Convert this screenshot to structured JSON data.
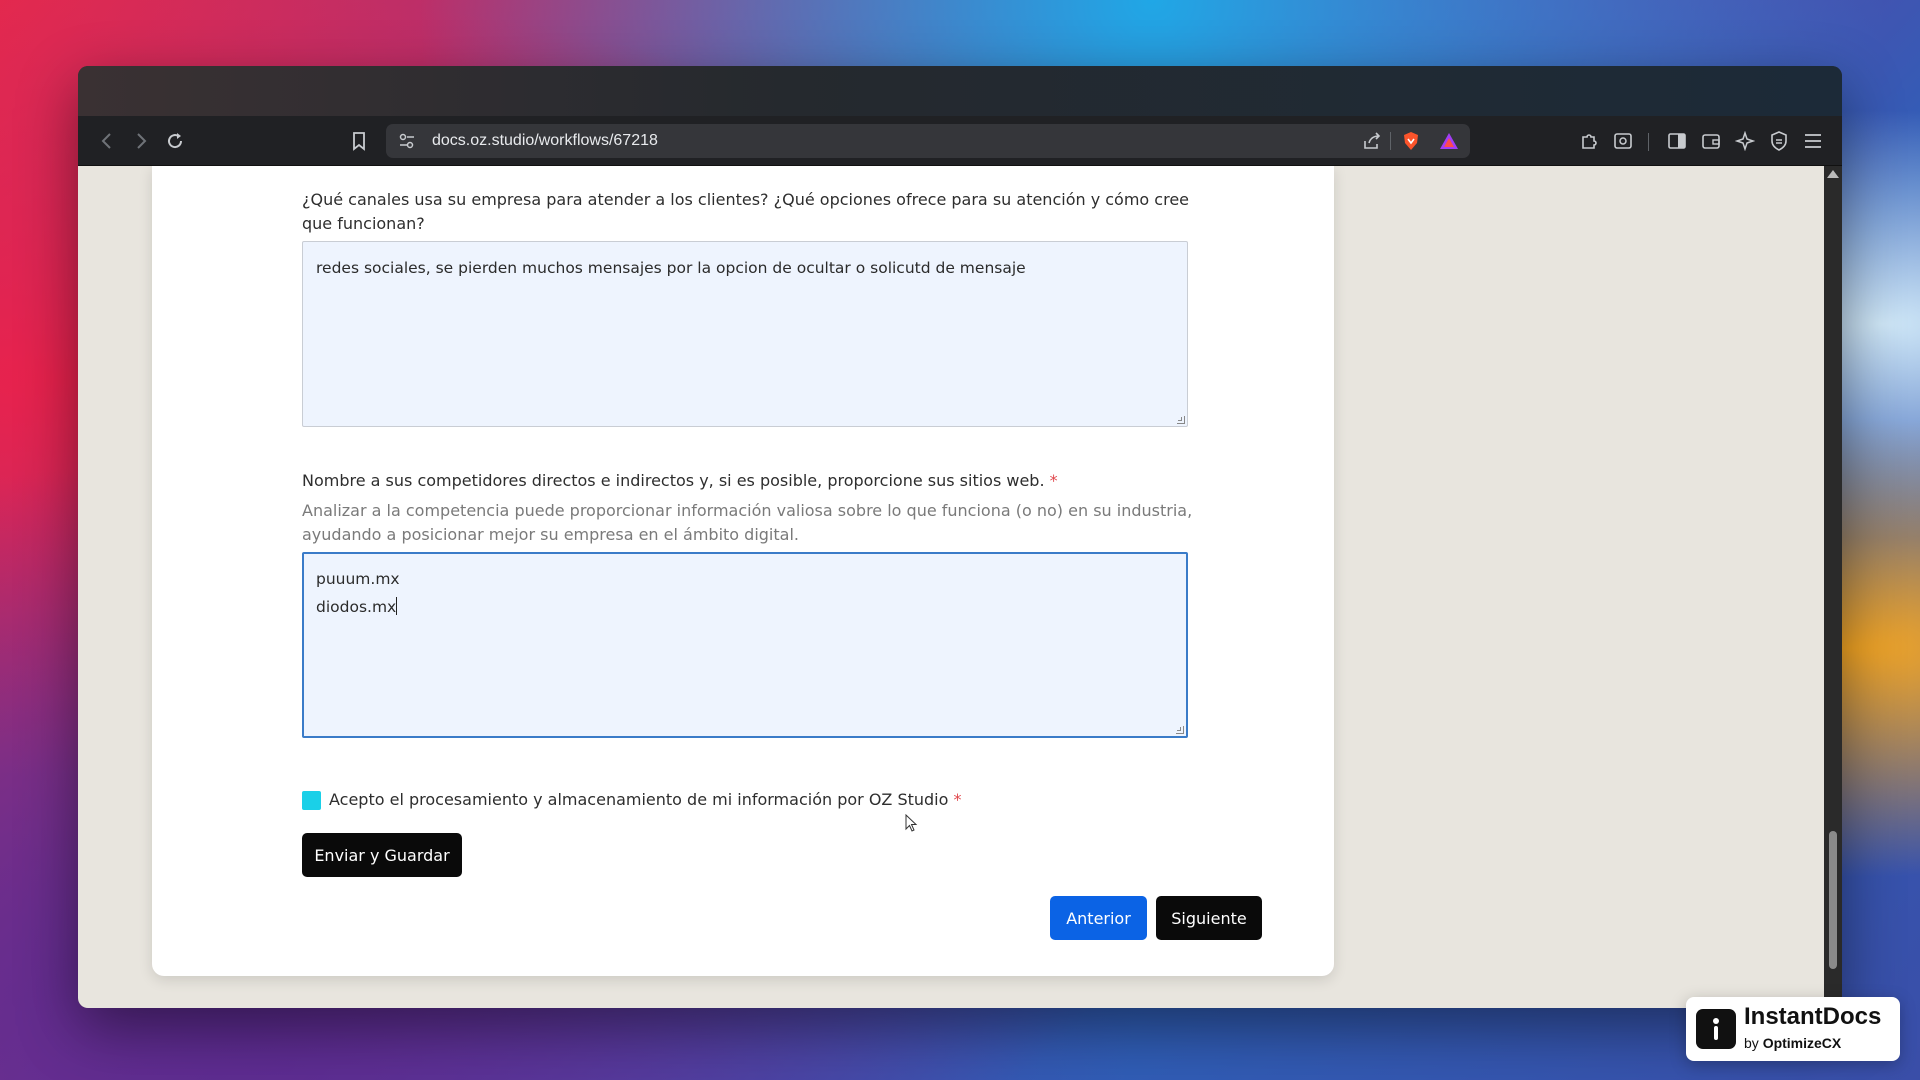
{
  "browser": {
    "url": "docs.oz.studio/workflows/67218"
  },
  "form": {
    "q1": {
      "label": "¿Qué canales usa su empresa para atender a los clientes? ¿Qué opciones ofrece para su atención y cómo cree que funcionan?",
      "value": "redes sociales, se pierden muchos mensajes por la opcion de ocultar o solicutd de mensaje"
    },
    "q2": {
      "label": "Nombre a sus competidores directos e indirectos y, si es posible, proporcione sus sitios web.",
      "required_mark": "*",
      "help": "Analizar a la competencia puede proporcionar información valiosa sobre lo que funciona (o no) en su industria, ayudando a posicionar mejor su empresa en el ámbito digital.",
      "value_lines": [
        "puuum.mx",
        "diodos.mx"
      ]
    },
    "consent": {
      "label": "Acepto el procesamiento y almacenamiento de mi información por OZ Studio",
      "required_mark": "*",
      "checked": true
    },
    "submit_label": "Enviar y Guardar",
    "prev_label": "Anterior",
    "next_label": "Siguiente"
  },
  "badge": {
    "title": "InstantDocs",
    "sub_prefix": "by",
    "sub_brand": "OptimizeCX"
  },
  "colors": {
    "primary_blue": "#0b63e5",
    "checkbox": "#1ad0e8",
    "required": "#e0474c",
    "textarea_bg": "#eef4fe"
  },
  "icons": {
    "back": "chevron-left-icon",
    "forward": "chevron-right-icon",
    "reload": "reload-icon",
    "bookmark": "bookmark-icon",
    "site_settings": "site-settings-icon",
    "share": "share-icon",
    "brave_shield": "brave-shield-icon",
    "rewards": "rewards-triangle-icon",
    "extensions": "puzzle-icon",
    "screenshot": "screenshot-icon",
    "sidebar": "sidebar-icon",
    "wallet": "wallet-icon",
    "leo_ai": "sparkle-icon",
    "vpn": "vpn-shield-icon",
    "menu": "hamburger-menu-icon"
  }
}
